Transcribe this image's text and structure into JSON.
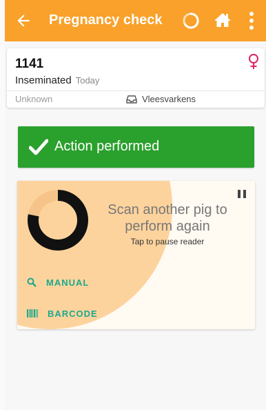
{
  "appbar": {
    "title": "Pregnancy check",
    "back_icon": "arrow-left-icon",
    "sync_icon": "loading-spinner-icon",
    "home_icon": "home-icon",
    "menu_icon": "more-vertical-icon",
    "color": "#f9a12a"
  },
  "animal": {
    "id": "1141",
    "status": "Inseminated",
    "status_when": "Today",
    "location": "Unknown",
    "pen": "Vleesvarkens",
    "sex_icon": "female-icon",
    "sex_color": "#e0245e"
  },
  "toast": {
    "message": "Action performed",
    "icon": "check-icon",
    "color": "#2aa02d"
  },
  "scanner": {
    "prompt_line1": "Scan another pig to",
    "prompt_line2": "perform again",
    "hint": "Tap to pause reader",
    "progress_fraction": 0.78,
    "pause_icon": "pause-icon",
    "manual_label": "MANUAL",
    "barcode_label": "BARCODE",
    "accent": "#1ba98c"
  }
}
